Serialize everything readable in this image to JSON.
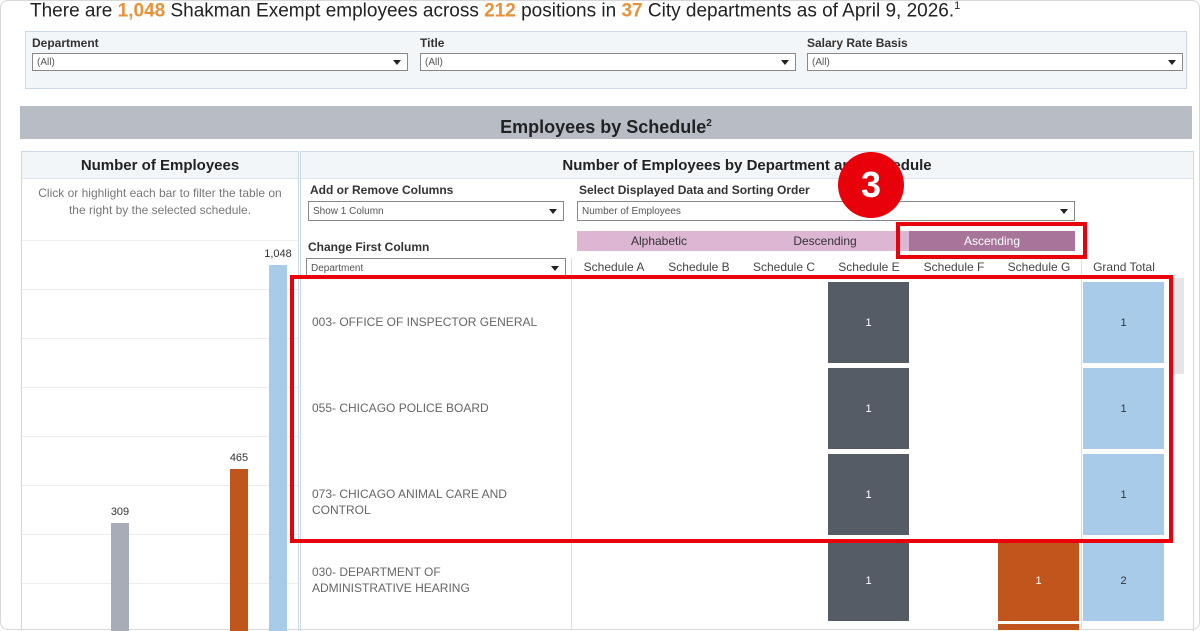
{
  "headline": {
    "prefix": "There are ",
    "employee_count": "1,048",
    "mid1": " Shakman Exempt employees across ",
    "position_count": "212",
    "mid2": " positions in ",
    "department_count": "37",
    "suffix": " City departments as of April 9, 2026.",
    "footnote": "1"
  },
  "filters": [
    {
      "label": "Department",
      "value": "(All)"
    },
    {
      "label": "Title",
      "value": "(All)"
    },
    {
      "label": "Salary Rate Basis",
      "value": "(All)"
    }
  ],
  "section": {
    "title": "Employees by Schedule",
    "footnote": "2"
  },
  "left_panel": {
    "title": "Number of Employees",
    "hint": "Click or highlight each bar to filter the table on the right by the selected schedule."
  },
  "right_panel": {
    "title": "Number of Employees by Department and Schedule",
    "add_remove_label": "Add or Remove Columns",
    "add_remove_value": "Show 1 Column",
    "displayed_data_label": "Select Displayed Data and Sorting Order",
    "displayed_data_value": "Number of Employees",
    "first_column_label": "Change First Column",
    "first_column_value": "Department",
    "sort_buttons": [
      "Alphabetic",
      "Descending",
      "Ascending"
    ],
    "columns": [
      "Schedule A",
      "Schedule B",
      "Schedule C",
      "Schedule E",
      "Schedule F",
      "Schedule G",
      "Grand Total"
    ],
    "rows": [
      {
        "label": "003-  OFFICE OF INSPECTOR GENERAL",
        "schedule_e": "1",
        "schedule_g": "",
        "total": "1"
      },
      {
        "label": "055-  CHICAGO POLICE BOARD",
        "schedule_e": "1",
        "schedule_g": "",
        "total": "1"
      },
      {
        "label": "073-  CHICAGO ANIMAL CARE AND CONTROL",
        "schedule_e": "1",
        "schedule_g": "",
        "total": "1"
      },
      {
        "label": "030-  DEPARTMENT OF ADMINISTRATIVE HEARING",
        "schedule_e": "1",
        "schedule_g": "1",
        "total": "2"
      }
    ]
  },
  "chart_data": {
    "type": "bar",
    "title": "Number of Employees",
    "categories": [
      "",
      "",
      ""
    ],
    "values": [
      309,
      465,
      1048
    ],
    "data_labels": [
      "309",
      "465",
      "1,048"
    ],
    "colors": [
      "#a7adb7",
      "#c0561b",
      "#a9cbea"
    ]
  },
  "annotation": {
    "step": "3"
  },
  "colors": {
    "accent_orange": "#e7913a",
    "schedule_e": "#555c66",
    "schedule_g": "#c0561b",
    "grand_total": "#a9cbea",
    "sort_active": "#a8759a",
    "sort_inactive": "#ddb6d4",
    "highlight": "#e8000b"
  }
}
